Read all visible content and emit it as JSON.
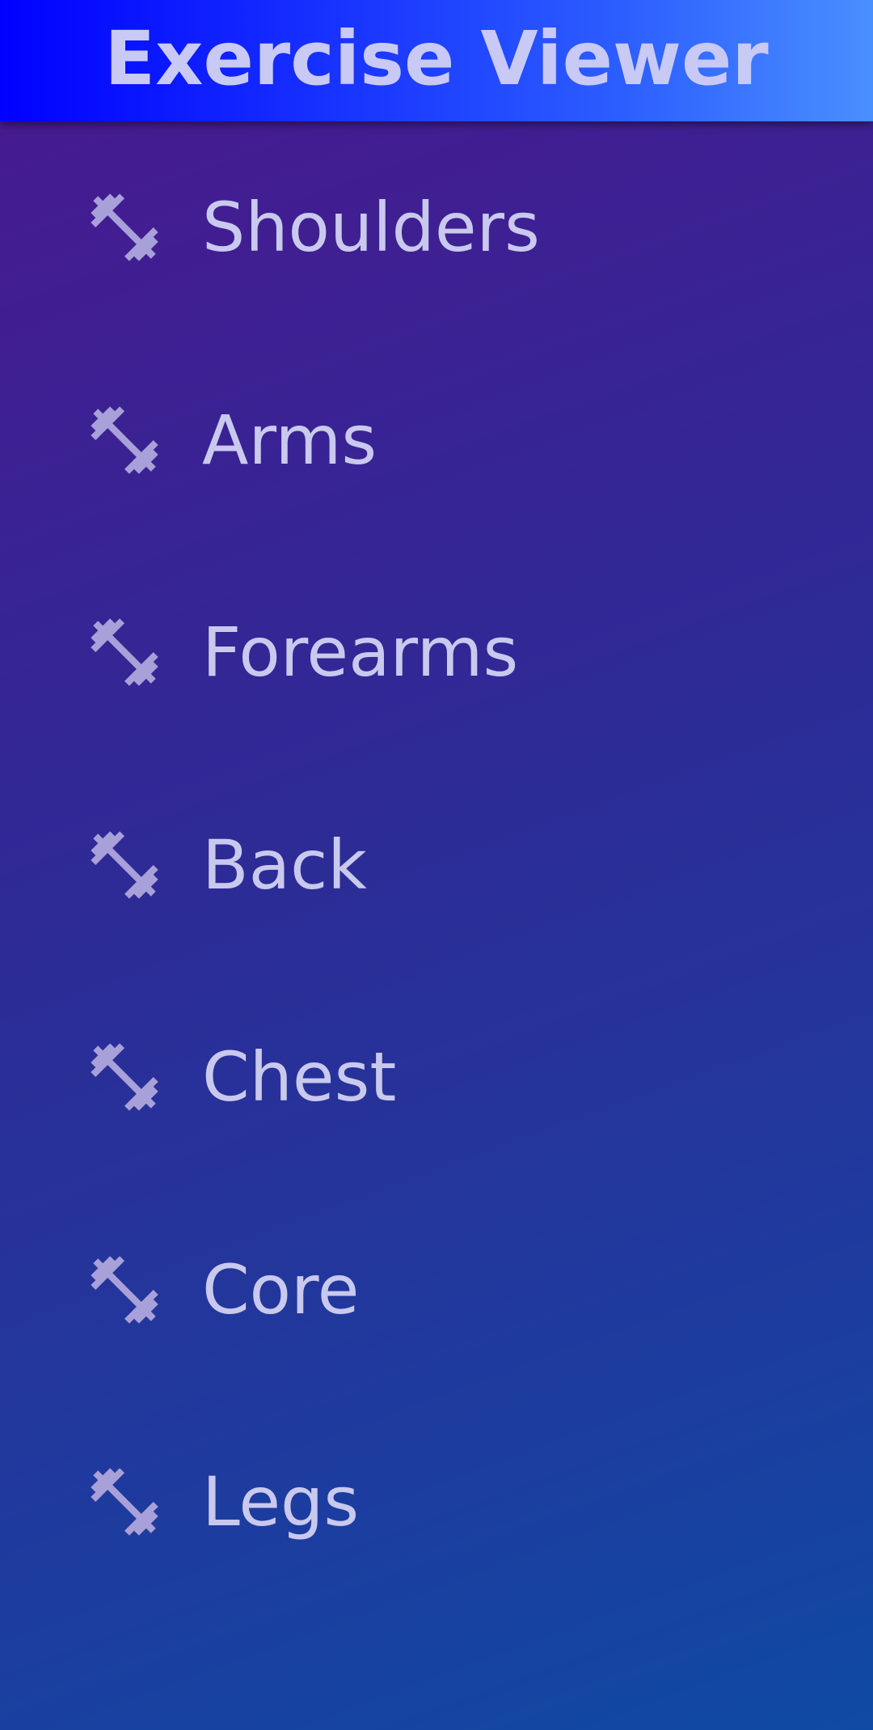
{
  "app_bar": {
    "title": "Exercise Viewer"
  },
  "icon_color": "#a8a0d8",
  "list": {
    "items": [
      {
        "label": "Shoulders",
        "icon": "dumbbell-icon"
      },
      {
        "label": "Arms",
        "icon": "dumbbell-icon"
      },
      {
        "label": "Forearms",
        "icon": "dumbbell-icon"
      },
      {
        "label": "Back",
        "icon": "dumbbell-icon"
      },
      {
        "label": "Chest",
        "icon": "dumbbell-icon"
      },
      {
        "label": "Core",
        "icon": "dumbbell-icon"
      },
      {
        "label": "Legs",
        "icon": "dumbbell-icon"
      }
    ]
  }
}
